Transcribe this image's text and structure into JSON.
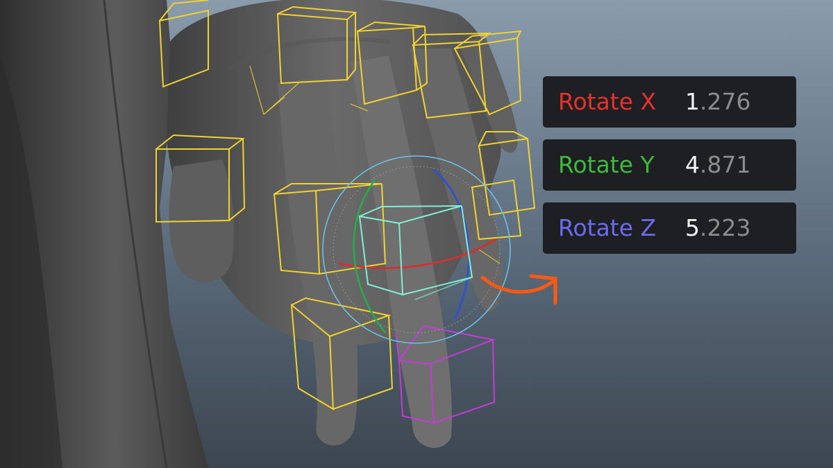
{
  "channels": [
    {
      "label": "Rotate X",
      "value_int": "1",
      "value_frac": ".276",
      "color": "#e8302c"
    },
    {
      "label": "Rotate Y",
      "value_int": "4",
      "value_frac": ".871",
      "color": "#3dbb3a"
    },
    {
      "label": "Rotate Z",
      "value_int": "5",
      "value_frac": ".223",
      "color": "#6b6bf0"
    }
  ],
  "scene": {
    "controls_color": "#f2d22e",
    "selected_control_color": "#7ff0d0",
    "highlight_control_color": "#c83ad8",
    "gizmo_x_color": "#e02a2a",
    "gizmo_y_color": "#22b04a",
    "gizmo_z_color": "#2a4ee0",
    "gizmo_view_color": "#6ec4e8",
    "arrow_color": "#ff5a14"
  }
}
